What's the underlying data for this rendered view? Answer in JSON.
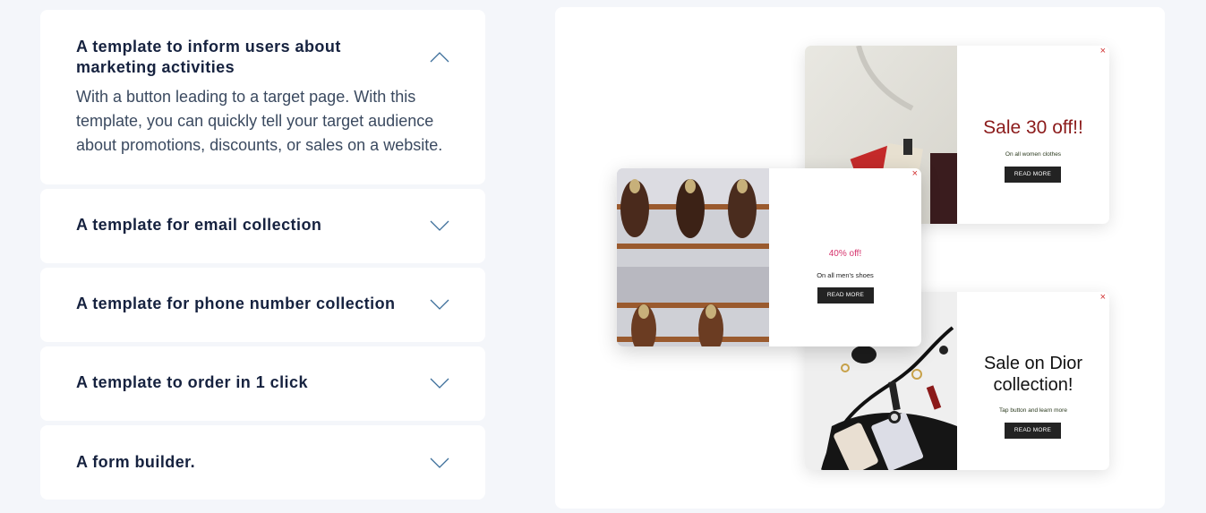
{
  "accordion": [
    {
      "title": "A template to inform users about marketing activities",
      "expanded": true,
      "description": "With a button leading to a target page. With this template, you can quickly tell your target audience about promotions, discounts, or sales on a website."
    },
    {
      "title": "A template for email collection",
      "expanded": false
    },
    {
      "title": "A template for phone number collection",
      "expanded": false
    },
    {
      "title": "A template to order in 1 click",
      "expanded": false
    },
    {
      "title": "A form builder.",
      "expanded": false
    }
  ],
  "popups": {
    "women": {
      "title": "Sale 30 off!!",
      "subtitle": "On all women clothes",
      "button": "READ MORE",
      "close": "×",
      "title_color": "#8b1a1a"
    },
    "shoes": {
      "title": "40% off!",
      "subtitle": "On all men's shoes",
      "button": "READ MORE",
      "close": "×",
      "title_color": "#d6336c"
    },
    "dior": {
      "title": "Sale on Dior collection!",
      "subtitle": "Tap button and learn more",
      "button": "READ MORE",
      "close": "×"
    }
  },
  "icons": {
    "collapse": "chevron-up-icon",
    "expand": "chevron-down-icon",
    "close": "close-icon"
  },
  "colors": {
    "heading": "#16223f",
    "body_text": "#3b4a60",
    "chevron": "#3d6f9b",
    "page_bg": "#f4f6fa"
  }
}
